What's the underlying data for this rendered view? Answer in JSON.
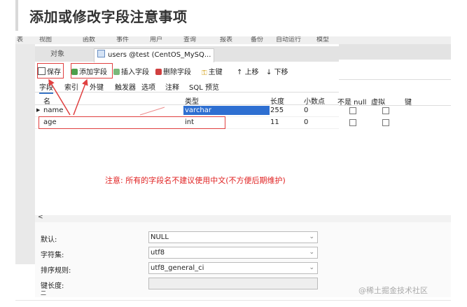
{
  "title": "添加或修改字段注意事项",
  "menubar": {
    "items": [
      "表",
      "视图",
      "函数",
      "事件",
      "用户",
      "查询",
      "报表",
      "备份",
      "自动运行",
      "模型"
    ]
  },
  "tabs": {
    "objects": "对象",
    "active": "users @test (CentOS_MySQ..."
  },
  "toolbar": {
    "save": "保存",
    "add_field": "添加字段",
    "insert_field": "插入字段",
    "delete_field": "删除字段",
    "primary_key": "主键",
    "move_up": "上移",
    "move_down": "下移"
  },
  "subtabs": [
    "字段",
    "索引",
    "外键",
    "触发器",
    "选项",
    "注释",
    "SQL 预览"
  ],
  "grid": {
    "headers": [
      "名",
      "类型",
      "长度",
      "小数点",
      "不是 null",
      "虚拟",
      "键"
    ],
    "rows": [
      {
        "name": "name",
        "type": "varchar",
        "length": "255",
        "decimals": "0"
      },
      {
        "name": "age",
        "type": "int",
        "length": "11",
        "decimals": "0"
      }
    ]
  },
  "scroll_left": "<",
  "props": {
    "default_label": "默认:",
    "default_value": "NULL",
    "charset_label": "字符集:",
    "charset_value": "utf8",
    "collation_label": "排序规则:",
    "collation_value": "utf8_general_ci",
    "keylen_label": "键长度:",
    "extra_label": "二"
  },
  "note": "注意: 所有的字段名不建议使用中文(不方便后期维护)",
  "watermark": "@稀土掘金技术社区",
  "colors": {
    "highlight": "#e04040",
    "selection": "#2e6fd1"
  }
}
